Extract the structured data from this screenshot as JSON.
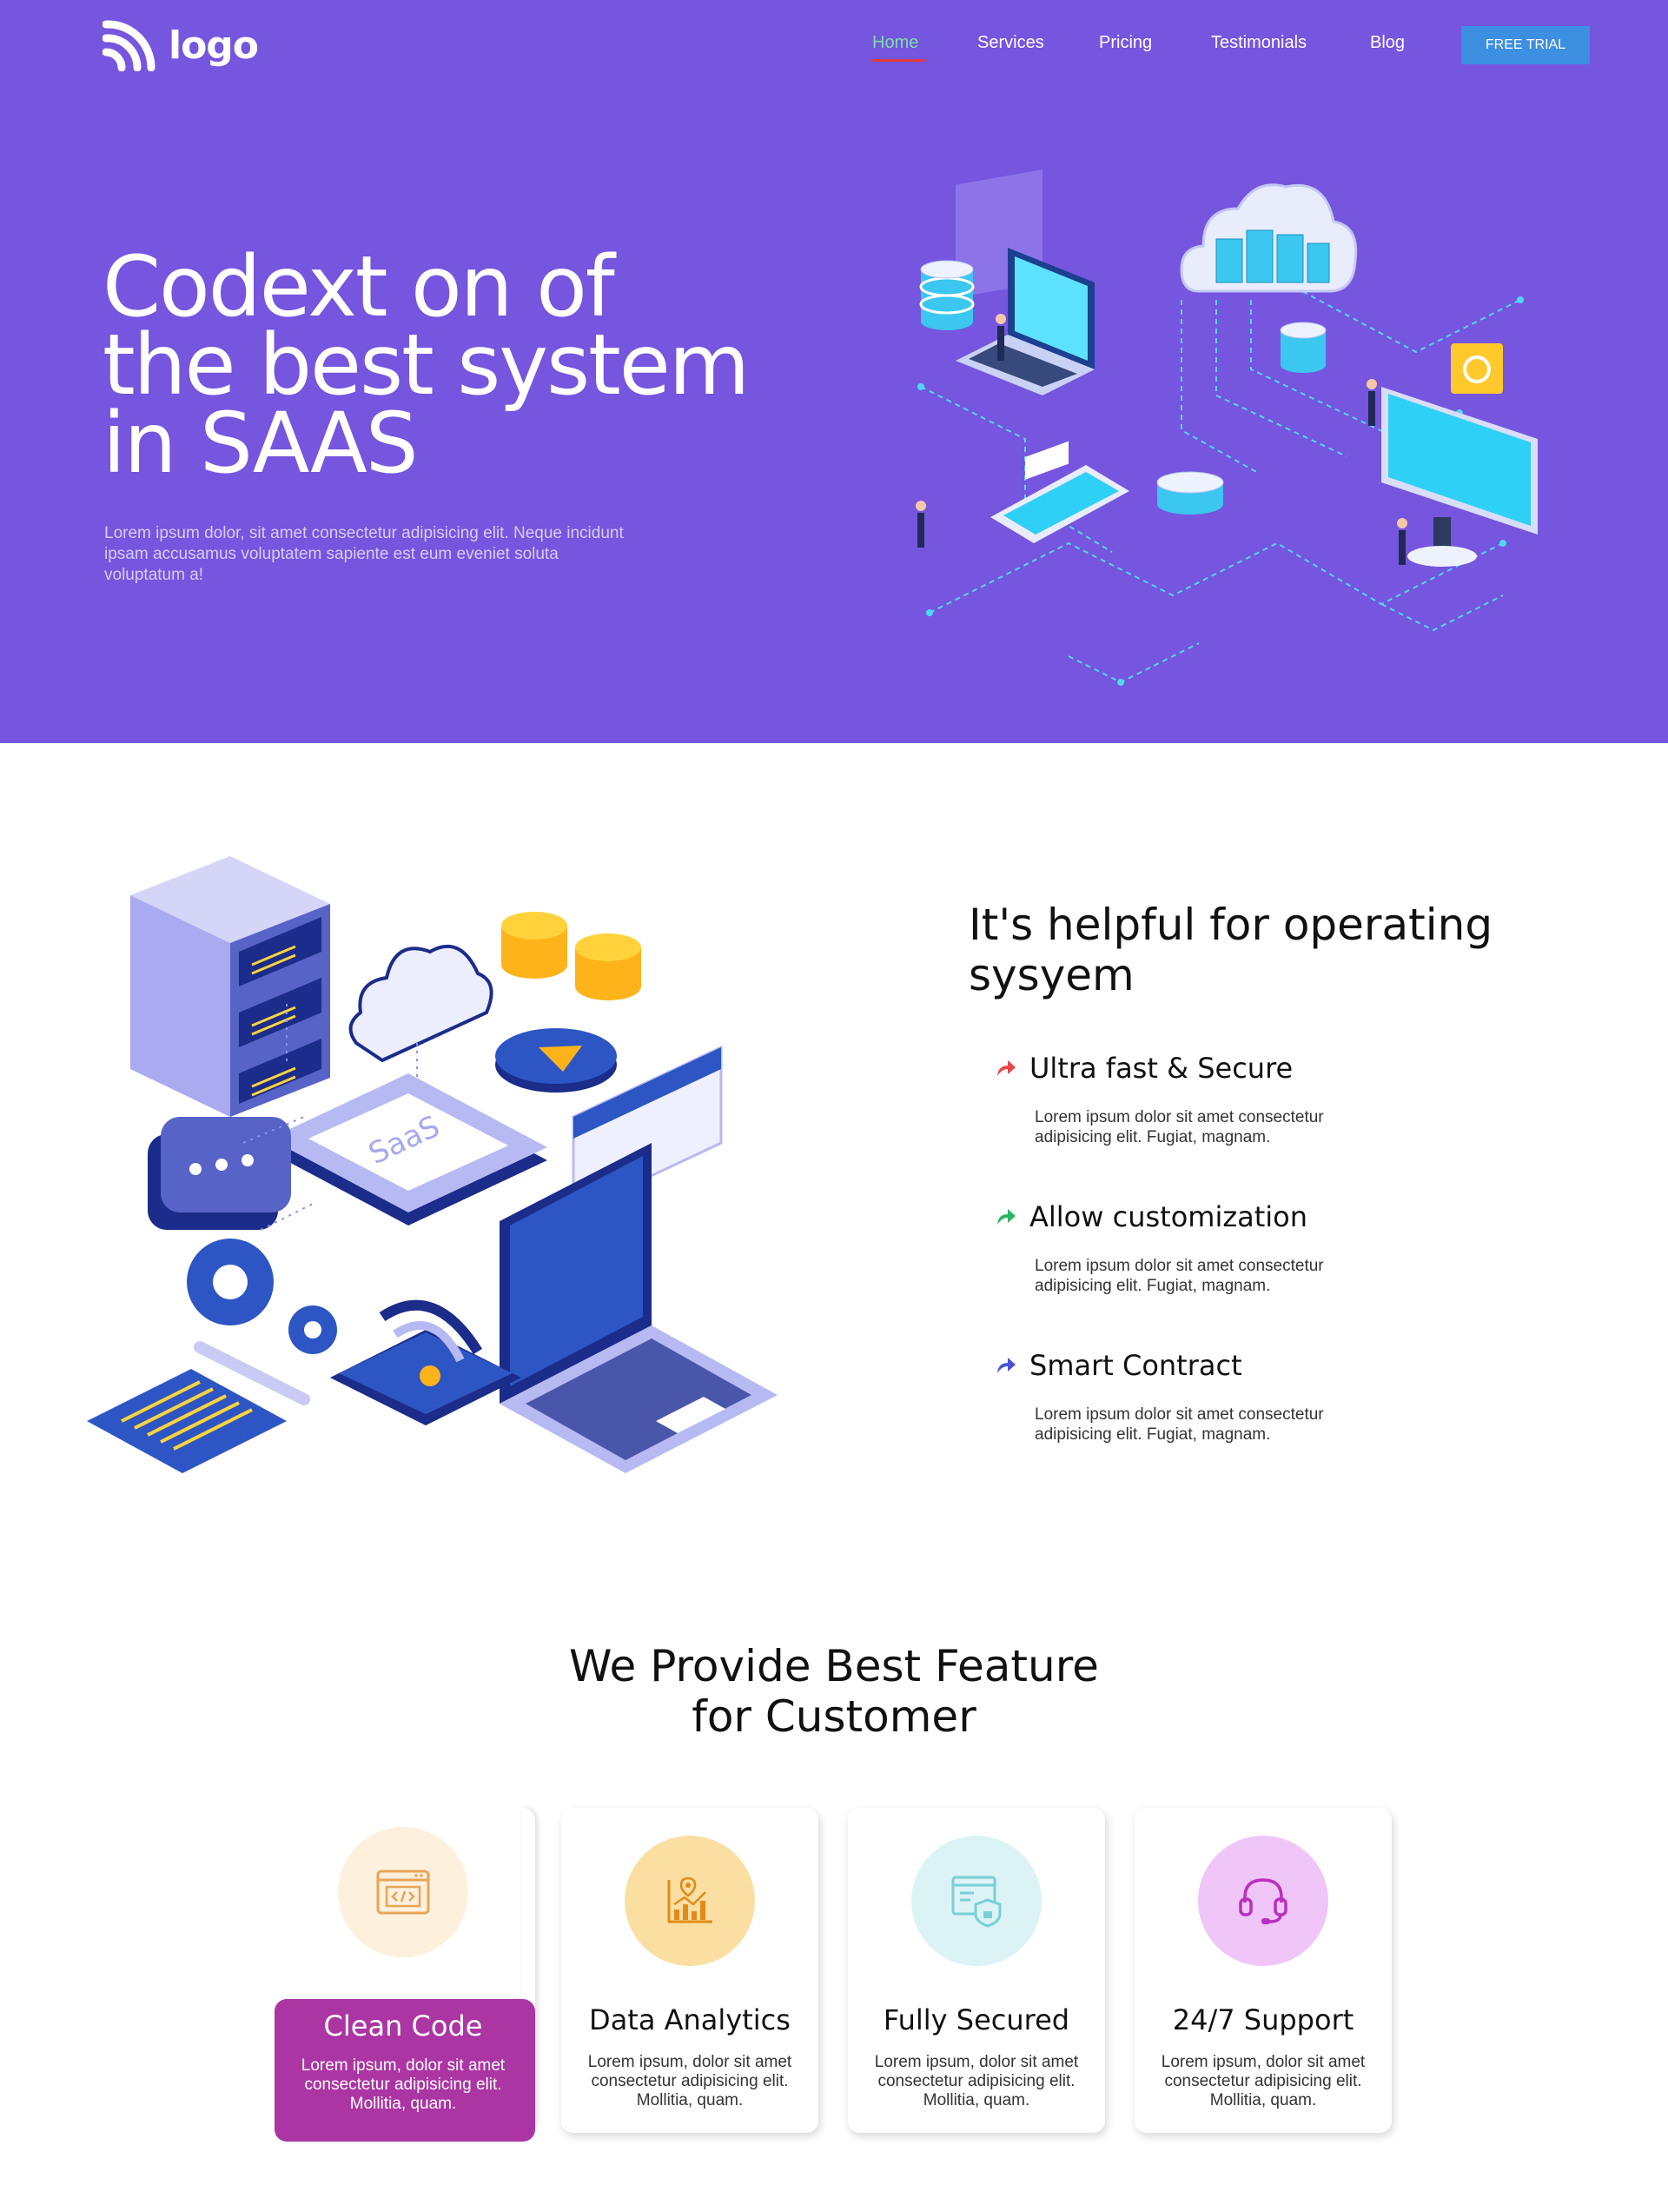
{
  "header": {
    "logo_text": "logo",
    "nav": [
      "Home",
      "Services",
      "Pricing",
      "Testimonials",
      "Blog"
    ],
    "cta": "FREE TRIAL"
  },
  "hero": {
    "title": "Codext on of the best system in SAAS",
    "description": "Lorem ipsum dolor, sit amet consectetur adipisicing elit. Neque incidunt ipsam accusamus voluptatem sapiente est eum eveniet soluta voluptatum a!"
  },
  "helpful": {
    "title": "It's helpful for operating sysyem",
    "features": [
      {
        "title": "Ultra fast & Secure",
        "description": "Lorem ipsum dolor sit amet consectetur adipisicing elit. Fugiat, magnam.",
        "icon": "share-arrow-icon",
        "color": "#e8464a"
      },
      {
        "title": "Allow customization",
        "description": "Lorem ipsum dolor sit amet consectetur adipisicing elit. Fugiat, magnam.",
        "icon": "share-arrow-icon",
        "color": "#2ab760"
      },
      {
        "title": "Smart Contract",
        "description": "Lorem ipsum dolor sit amet consectetur adipisicing elit. Fugiat, magnam.",
        "icon": "share-arrow-icon",
        "color": "#4b52d8"
      }
    ]
  },
  "features_section": {
    "title": "We Provide Best Feature for Customer",
    "cards": [
      {
        "title": "Clean Code",
        "description": "Lorem ipsum, dolor sit amet consectetur adipisicing elit. Mollitia, quam.",
        "icon": "code-window-icon"
      },
      {
        "title": "Data Analytics",
        "description": "Lorem ipsum, dolor sit amet consectetur adipisicing elit. Mollitia, quam.",
        "icon": "analytics-chart-icon"
      },
      {
        "title": "Fully Secured",
        "description": "Lorem ipsum, dolor sit amet consectetur adipisicing elit. Mollitia, quam.",
        "icon": "secure-document-icon"
      },
      {
        "title": "24/7 Support",
        "description": "Lorem ipsum, dolor sit amet consectetur adipisicing elit. Mollitia, quam.",
        "icon": "headset-icon"
      }
    ]
  },
  "colors": {
    "hero_bg": "#7655df",
    "cta_bg": "#3c8fe1",
    "highlight_card": "#ab35a3",
    "nav_active": "#7be0a6",
    "nav_underline": "#e23b3b"
  }
}
